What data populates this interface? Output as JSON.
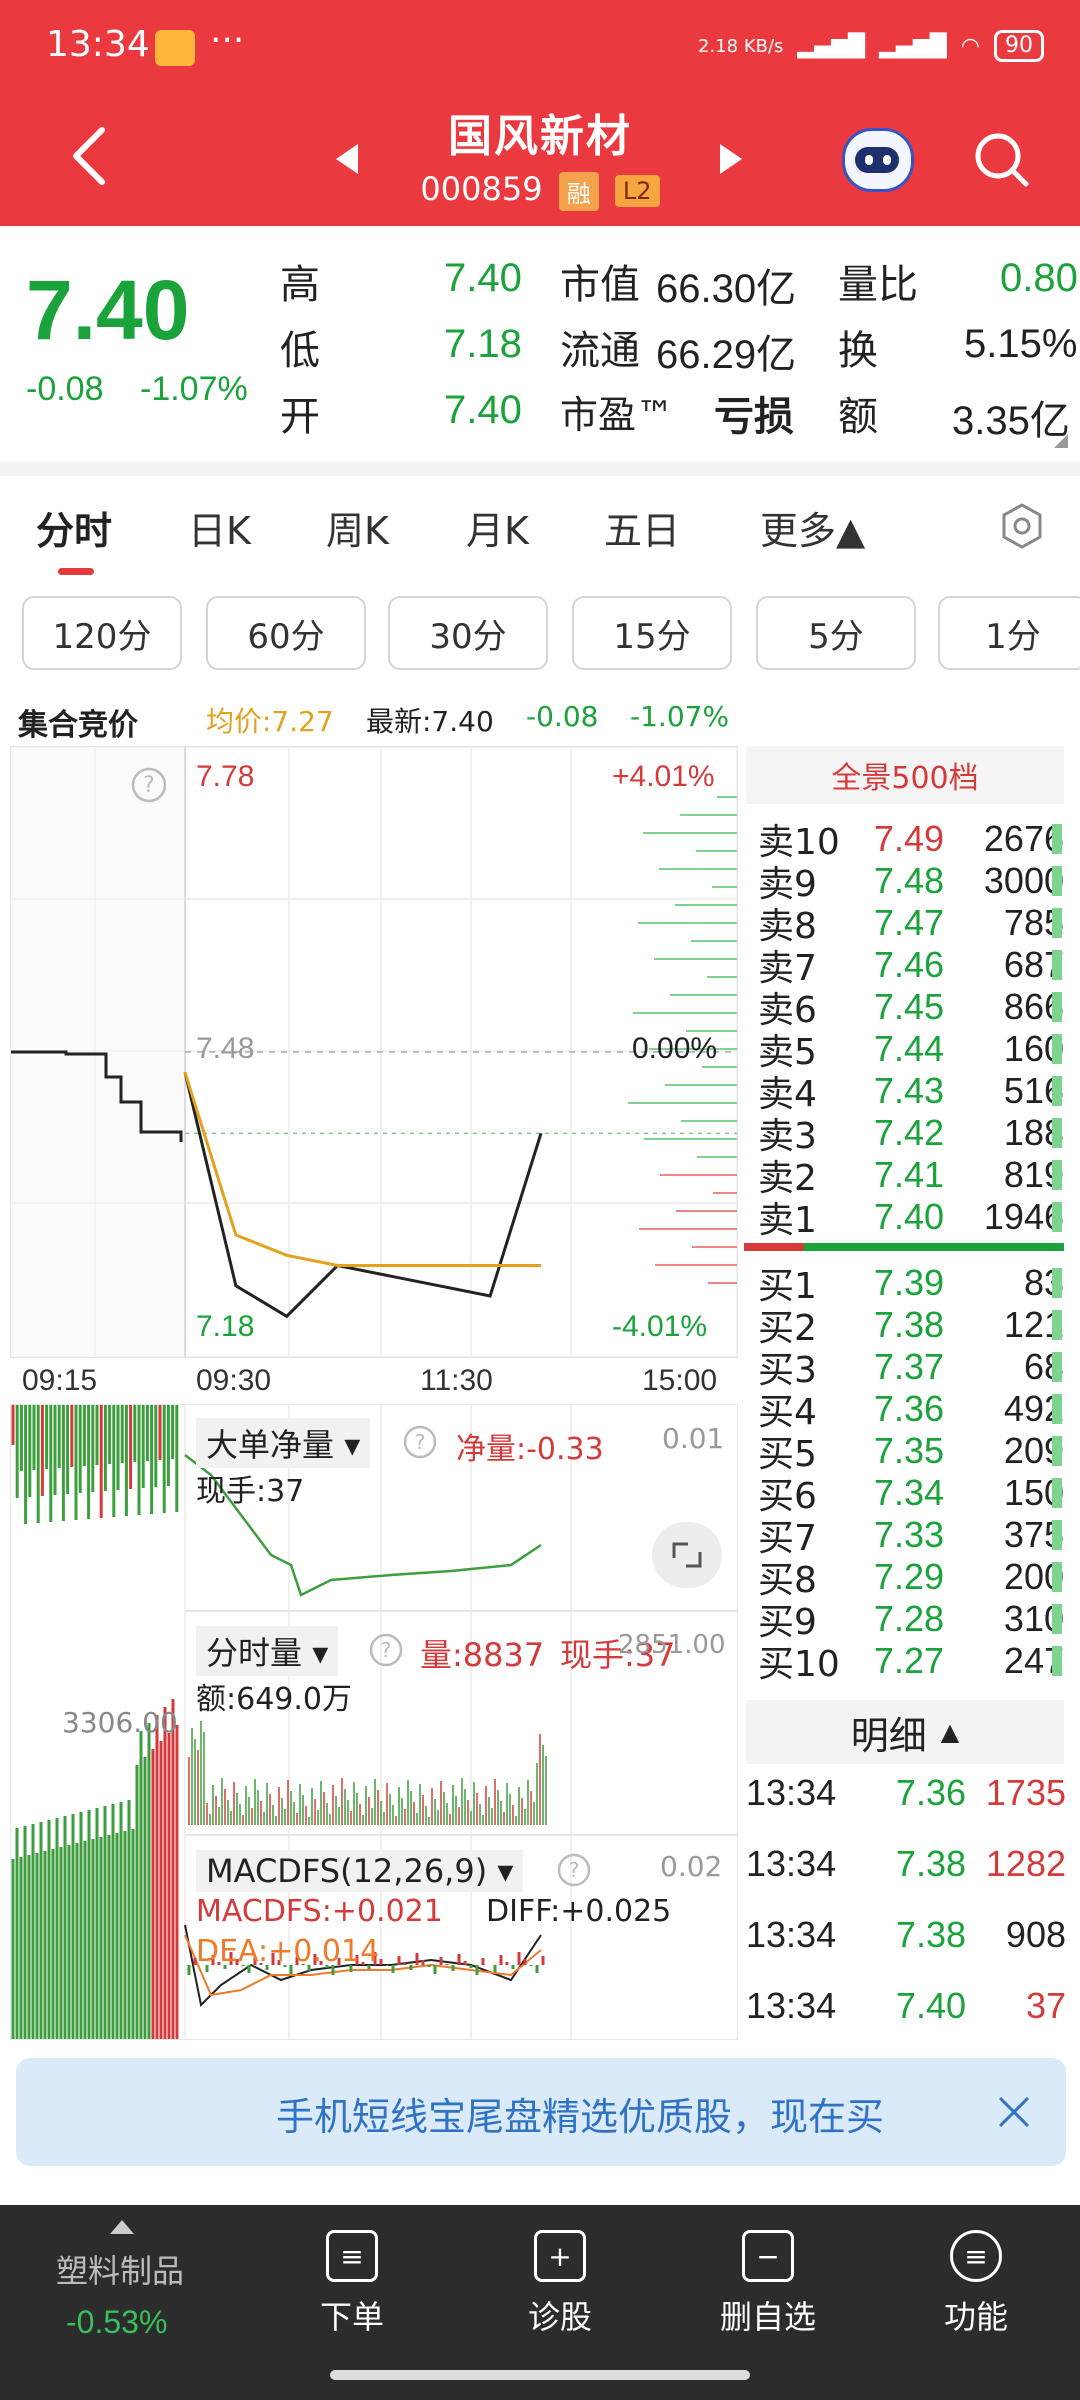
{
  "status": {
    "time": "13:34",
    "dots": "···",
    "net": "2.18 KB/s",
    "signal": "HD",
    "battery": "90"
  },
  "header": {
    "title": "国风新材",
    "code": "000859",
    "tag_rong": "融",
    "tag_l2": "L2"
  },
  "quote": {
    "price": "7.40",
    "change": "-0.08",
    "change_pct": "-1.07%",
    "high_label": "高",
    "high": "7.40",
    "low_label": "低",
    "low": "7.18",
    "open_label": "开",
    "open": "7.40",
    "mcap_label": "市值",
    "mcap": "66.30亿",
    "float_label": "流通",
    "float": "66.29亿",
    "pe_label": "市盈™",
    "pe": "亏损",
    "vr_label": "量比",
    "vr": "0.80",
    "turn_label": "换",
    "turn": "5.15%",
    "amt_label": "额",
    "amt": "3.35亿"
  },
  "tabs": [
    "分时",
    "日K",
    "周K",
    "月K",
    "五日",
    "更多▲"
  ],
  "periods": [
    "120分",
    "60分",
    "30分",
    "15分",
    "5分",
    "1分"
  ],
  "info": {
    "auction": "集合竞价",
    "avg": "均价:7.27",
    "latest": "最新:7.40",
    "chg": "-0.08",
    "pct": "-1.07%"
  },
  "chart": {
    "top_price": "7.78",
    "top_pct": "+4.01%",
    "mid_price": "7.48",
    "mid_pct": "0.00%",
    "bot_price": "7.18",
    "bot_pct": "-4.01%",
    "times": [
      "09:15",
      "09:30",
      "11:30",
      "15:00"
    ]
  },
  "chart_data": {
    "type": "line",
    "title": "",
    "x": [
      "09:30",
      "10:00",
      "10:30",
      "11:00",
      "11:30",
      "13:00",
      "13:30",
      "13:34"
    ],
    "series": [
      {
        "values": [
          7.46,
          7.25,
          7.22,
          7.27,
          7.26,
          7.25,
          7.24,
          7.4
        ]
      },
      {
        "values": [
          7.46,
          7.3,
          7.28,
          7.27,
          7.27,
          7.27,
          7.27,
          7.27
        ]
      }
    ],
    "ylim": [
      7.18,
      7.78
    ]
  },
  "subpanels": {
    "big": {
      "title": "大单净量",
      "net_label": "净量:-0.33",
      "hand": "现手:37",
      "scale": "0.01"
    },
    "vol": {
      "title": "分时量",
      "vol": "量:8837",
      "hand": "现手:37",
      "amount": "额:649.0万",
      "right_scale": "2851.00",
      "left_scale": "3306.00"
    },
    "macd": {
      "title": "MACDFS(12,26,9)",
      "macdfs": "MACDFS:+0.021",
      "diff": "DIFF:+0.025",
      "dea": "DEA:+0.014",
      "scale": "0.02"
    }
  },
  "orderbook": {
    "title": "全景500档",
    "sells": [
      {
        "n": "卖10",
        "p": "7.49",
        "v": "2676"
      },
      {
        "n": "卖9",
        "p": "7.48",
        "v": "3000"
      },
      {
        "n": "卖8",
        "p": "7.47",
        "v": "785"
      },
      {
        "n": "卖7",
        "p": "7.46",
        "v": "687"
      },
      {
        "n": "卖6",
        "p": "7.45",
        "v": "866"
      },
      {
        "n": "卖5",
        "p": "7.44",
        "v": "160"
      },
      {
        "n": "卖4",
        "p": "7.43",
        "v": "516"
      },
      {
        "n": "卖3",
        "p": "7.42",
        "v": "188"
      },
      {
        "n": "卖2",
        "p": "7.41",
        "v": "819"
      },
      {
        "n": "卖1",
        "p": "7.40",
        "v": "1946"
      }
    ],
    "buys": [
      {
        "n": "买1",
        "p": "7.39",
        "v": "83"
      },
      {
        "n": "买2",
        "p": "7.38",
        "v": "121"
      },
      {
        "n": "买3",
        "p": "7.37",
        "v": "68"
      },
      {
        "n": "买4",
        "p": "7.36",
        "v": "492"
      },
      {
        "n": "买5",
        "p": "7.35",
        "v": "209"
      },
      {
        "n": "买6",
        "p": "7.34",
        "v": "150"
      },
      {
        "n": "买7",
        "p": "7.33",
        "v": "375"
      },
      {
        "n": "买8",
        "p": "7.29",
        "v": "200"
      },
      {
        "n": "买9",
        "p": "7.28",
        "v": "310"
      },
      {
        "n": "买10",
        "p": "7.27",
        "v": "247"
      }
    ]
  },
  "detail": {
    "title": "明细",
    "rows": [
      {
        "t": "13:34",
        "p": "7.36",
        "v": "1735",
        "c": "#d53a3a"
      },
      {
        "t": "13:34",
        "p": "7.38",
        "v": "1282",
        "c": "#d53a3a"
      },
      {
        "t": "13:34",
        "p": "7.38",
        "v": "908",
        "c": "#222222"
      },
      {
        "t": "13:34",
        "p": "7.40",
        "v": "37",
        "c": "#d53a3a"
      }
    ]
  },
  "banner": {
    "text": "手机短线宝尾盘精选优质股，现在买"
  },
  "bottom_nav": {
    "sector": "塑料制品",
    "sector_pct": "-0.53%",
    "items": [
      "下单",
      "诊股",
      "删自选",
      "功能"
    ]
  }
}
